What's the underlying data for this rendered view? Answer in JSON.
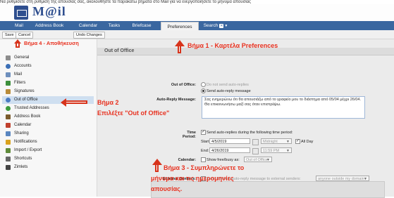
{
  "caption": "Να ρυθμίσετε στη ρύθμιση της απουσίας σας, ακολουθήστε τα παρακάτω βήματα στο Mail για να ενεργοποιήσετε το μήνυμα απουσίας",
  "app": {
    "logo_text": "M@il"
  },
  "tabs": [
    {
      "label": "Mail"
    },
    {
      "label": "Address Book"
    },
    {
      "label": "Calendar"
    },
    {
      "label": "Tasks"
    },
    {
      "label": "Briefcase"
    },
    {
      "label": "Preferences"
    },
    {
      "label": "Search"
    }
  ],
  "toolbar": {
    "save_label": "Save",
    "cancel_label": "Cancel",
    "undo_label": "Undo Changes"
  },
  "sidebar": {
    "items": [
      {
        "label": "General",
        "icon": "gear-icon",
        "color": "#8c8c8c"
      },
      {
        "label": "Accounts",
        "icon": "accounts-icon",
        "color": "#3b6fb6"
      },
      {
        "label": "Mail",
        "icon": "mail-icon",
        "color": "#6e8fbd"
      },
      {
        "label": "Filters",
        "icon": "filter-icon",
        "color": "#3d8f3d"
      },
      {
        "label": "Signatures",
        "icon": "signature-icon",
        "color": "#b98c3a"
      },
      {
        "label": "Out of Office",
        "icon": "out-of-office-icon",
        "color": "#4b7cc2"
      },
      {
        "label": "Trusted Addresses",
        "icon": "trusted-icon",
        "color": "#3d9b3d"
      },
      {
        "label": "Address Book",
        "icon": "address-book-icon",
        "color": "#7a5b2c"
      },
      {
        "label": "Calendar",
        "icon": "calendar-icon",
        "color": "#c0402d"
      },
      {
        "label": "Sharing",
        "icon": "sharing-icon",
        "color": "#5a86c0"
      },
      {
        "label": "Notifications",
        "icon": "notification-icon",
        "color": "#d9a21e"
      },
      {
        "label": "Import / Export",
        "icon": "import-export-icon",
        "color": "#5f8b3a"
      },
      {
        "label": "Shortcuts",
        "icon": "shortcuts-icon",
        "color": "#666666"
      },
      {
        "label": "Zimlets",
        "icon": "zimlets-icon",
        "color": "#444444"
      }
    ]
  },
  "content": {
    "title": "Out of Office",
    "out_of_office_label": "Out of Office:",
    "radio_off": "Do not send auto-replies",
    "radio_on": "Send auto-reply message",
    "auto_reply_label": "Auto-Reply Message:",
    "auto_reply_text": "Σας ενημερώνω ότι θα απουσιάζω από το γραφείο μου το διάστημα από 05/04 μέχρι 26/04. Θα επικοινωνήσω μαζί σας όταν επιστρέψω.",
    "time_period_label": "Time Period:",
    "time_period_check": "Send auto-replies during the following time period:",
    "start_label": "Start:",
    "start_date": "4/5/2019",
    "start_time": "Midnight",
    "all_day": "All Day",
    "end_label": "End:",
    "end_date": "4/26/2019",
    "end_time": "11:59 PM",
    "calendar_label": "Calendar:",
    "calendar_check": "Show free/busy as:",
    "calendar_value": "Out of Office",
    "external_label": "External Senders:",
    "external_check": "Send different auto-reply message to external senders:",
    "external_value": "anyone outside my domain"
  },
  "annotations": {
    "step1": "Βήμα 1 - Καρτέλα Preferences",
    "step2_line1": "Βήμα 2",
    "step2_line2": "Επιλέξτε \"Out of Office\"",
    "step3_line1": "Βήμα 3 - Συμπληρώνετε το",
    "step3_line2": "μήνυμα και τις ημερομηνίες",
    "step3_line3": "απουσίας.",
    "step4": "Βήμα 4 - Αποθήκευση",
    "color": "#e8301e"
  }
}
